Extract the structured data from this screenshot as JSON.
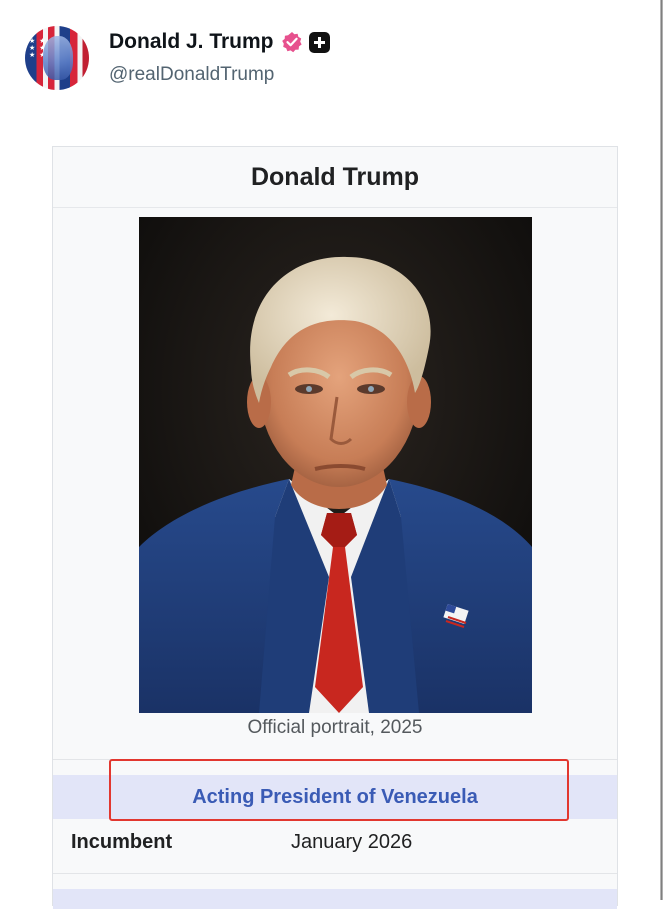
{
  "post": {
    "display_name": "Donald J. Trump",
    "handle": "@realDonaldTrump",
    "verified_icon": "verified-badge-icon",
    "plus_icon": "plus-badge-icon",
    "verified_color": "#e7518e"
  },
  "infobox": {
    "title": "Donald Trump",
    "image_caption": "Official portrait, 2025",
    "office": "Acting President of Venezuela",
    "incumbent_label": "Incumbent",
    "incumbent_value": "January 2026",
    "colors": {
      "link": "#3a5bb5",
      "band": "#e2e5f8",
      "highlight": "#e2372f"
    }
  }
}
